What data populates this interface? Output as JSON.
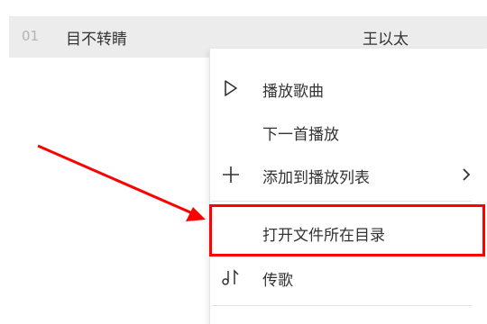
{
  "song": {
    "index": "01",
    "title": "目不转睛",
    "artist": "王以太"
  },
  "context_menu": {
    "items": [
      {
        "label": "播放歌曲",
        "icon": "play-icon"
      },
      {
        "label": "下一首播放",
        "icon": ""
      },
      {
        "label": "添加到播放列表",
        "icon": "plus-icon",
        "submenu": "chevron-right-icon"
      },
      {
        "label": "打开文件所在目录",
        "icon": ""
      },
      {
        "label": "传歌",
        "icon": "music-transfer-icon"
      }
    ]
  },
  "annotation": {
    "highlight_color": "#ff0000",
    "arrow_color": "#ff0000"
  }
}
